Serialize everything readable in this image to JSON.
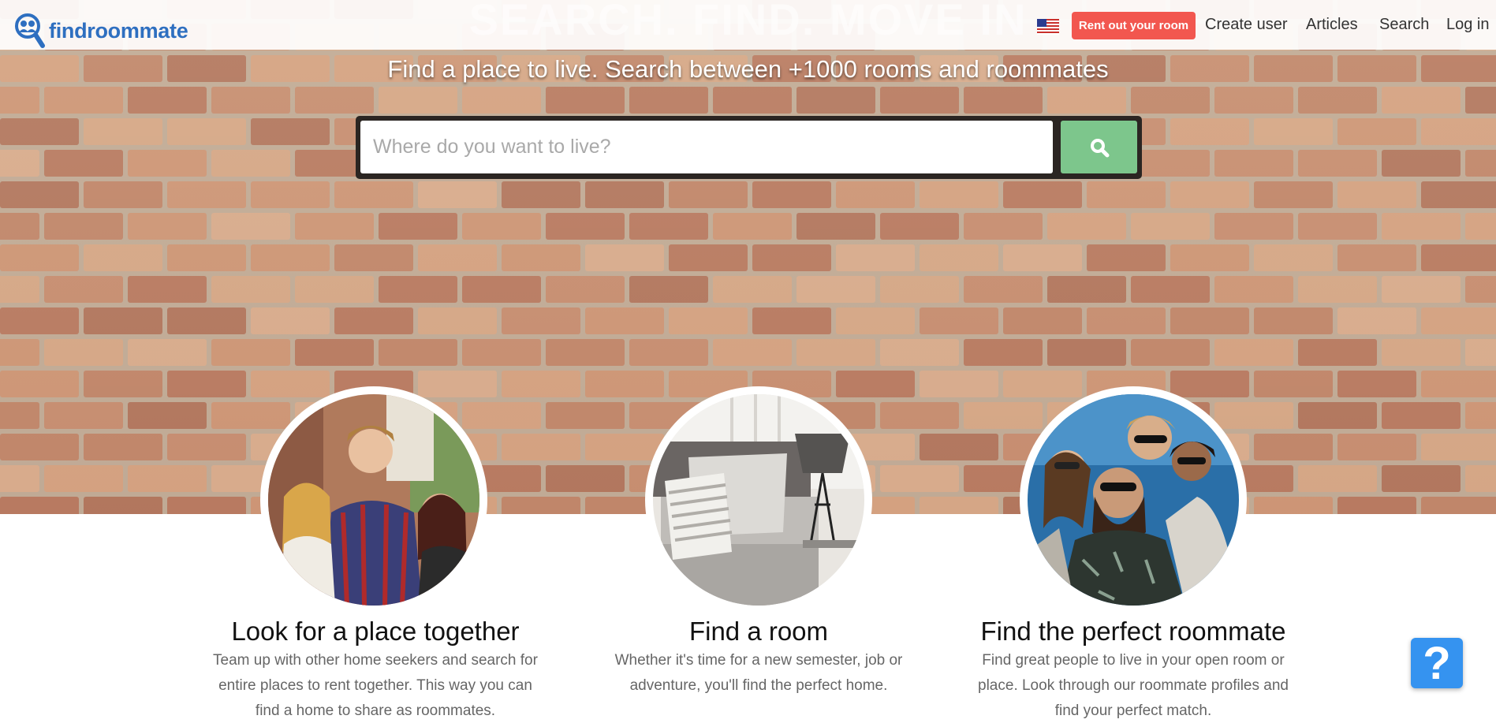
{
  "hero": {
    "title": "SEARCH. FIND. MOVE IN",
    "subtitle": "Find a place to live. Search between +1000 rooms and roommates"
  },
  "brand": {
    "name": "findroommate",
    "logo_icon": "magnifier-people-icon",
    "color": "#2e6fc0"
  },
  "nav": {
    "flag_icon": "us-flag-icon",
    "rent_button": "Rent out your room",
    "links": [
      "Create user",
      "Articles",
      "Search",
      "Log in"
    ]
  },
  "search": {
    "placeholder": "Where do you want to live?",
    "button_icon": "search-icon",
    "button_color": "#7dc68c"
  },
  "features": [
    {
      "title": "Look for a place together",
      "text": "Team up with other home seekers and search for entire places to rent together. This way you can find a home to share as roommates."
    },
    {
      "title": "Find a room",
      "text": "Whether it's time for a new semester, job or adventure, you'll find the perfect home."
    },
    {
      "title": "Find the perfect roommate",
      "text": "Find great people to live in your open room or place. Look through our roommate profiles and find your perfect match."
    }
  ],
  "help": {
    "label": "?",
    "icon": "help-icon",
    "color": "#3593f0"
  },
  "colors": {
    "rent_button": "#f2574f",
    "brick": "#c08e6e"
  }
}
